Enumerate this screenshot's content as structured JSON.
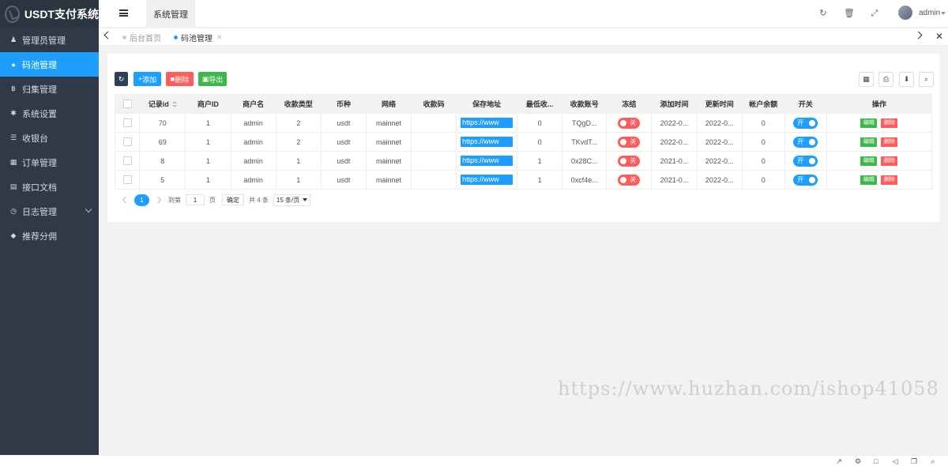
{
  "sidebar": {
    "logo": "USDT支付系统",
    "items": [
      {
        "label": "管理员管理",
        "icon": "user-icon",
        "glyph": "♟"
      },
      {
        "label": "码池管理",
        "icon": "circle-icon",
        "glyph": "●",
        "active": true
      },
      {
        "label": "归集管理",
        "icon": "bitcoin-icon",
        "glyph": "฿"
      },
      {
        "label": "系统设置",
        "icon": "gear-icon",
        "glyph": "✱"
      },
      {
        "label": "收银台",
        "icon": "list-icon",
        "glyph": "☰"
      },
      {
        "label": "订单管理",
        "icon": "calculator-icon",
        "glyph": "▦"
      },
      {
        "label": "接口文档",
        "icon": "doc-icon",
        "glyph": "▤"
      },
      {
        "label": "日志管理",
        "icon": "clock-icon",
        "glyph": "◷",
        "has_submenu": true
      },
      {
        "label": "推荐分佣",
        "icon": "android-icon",
        "glyph": "◆"
      }
    ]
  },
  "header": {
    "tab": "系统管理",
    "user": "admin"
  },
  "tabs": {
    "home": "后台首页",
    "current": "码池管理"
  },
  "toolbar": {
    "add": "添加",
    "delete": "删除",
    "export": "导出"
  },
  "table": {
    "headers": [
      "记录id",
      "商户ID",
      "商户名",
      "收款类型",
      "币种",
      "网络",
      "收款码",
      "保存地址",
      "最低收...",
      "收款账号",
      "冻结",
      "添加时间",
      "更新时间",
      "帐户余额",
      "开关",
      "操作"
    ],
    "rows": [
      {
        "id": "70",
        "merchant_id": "1",
        "merchant_name": "admin",
        "type": "2",
        "currency": "usdt",
        "network": "mainnet",
        "code": "",
        "address": "https://www",
        "min": "0",
        "account": "TQgD...",
        "freeze": "关",
        "created": "2022-0...",
        "updated": "2022-0...",
        "balance": "0",
        "switch": "开"
      },
      {
        "id": "69",
        "merchant_id": "1",
        "merchant_name": "admin",
        "type": "2",
        "currency": "usdt",
        "network": "mainnet",
        "code": "",
        "address": "https://www",
        "min": "0",
        "account": "TKvdT...",
        "freeze": "关",
        "created": "2022-0...",
        "updated": "2022-0...",
        "balance": "0",
        "switch": "开"
      },
      {
        "id": "8",
        "merchant_id": "1",
        "merchant_name": "admin",
        "type": "1",
        "currency": "usdt",
        "network": "mainnet",
        "code": "",
        "address": "https://www",
        "min": "1",
        "account": "0x28C...",
        "freeze": "关",
        "created": "2021-0...",
        "updated": "2022-0...",
        "balance": "0",
        "switch": "开"
      },
      {
        "id": "5",
        "merchant_id": "1",
        "merchant_name": "admin",
        "type": "1",
        "currency": "usdt",
        "network": "mainnet",
        "code": "",
        "address": "https://www",
        "min": "1",
        "account": "0xcf4e...",
        "freeze": "关",
        "created": "2021-0...",
        "updated": "2022-0...",
        "balance": "0",
        "switch": "开"
      }
    ],
    "edit": "编辑",
    "delete": "删除"
  },
  "pager": {
    "current": "1",
    "goto": "到第",
    "page_value": "1",
    "page_unit": "页",
    "confirm": "确定",
    "total": "共 4 条",
    "page_size": "15 条/页"
  },
  "watermark": "https://www.huzhan.com/ishop41058"
}
